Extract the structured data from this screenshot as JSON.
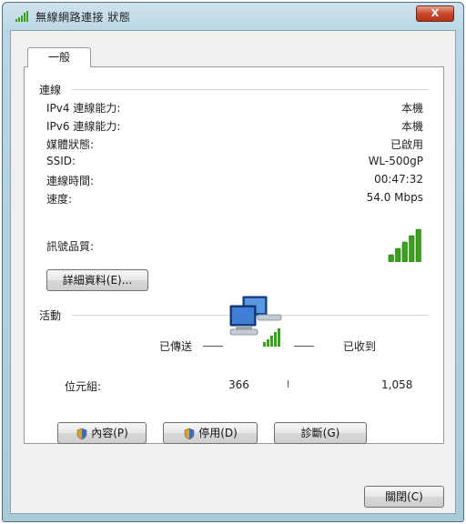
{
  "window": {
    "title": "無線網路連接 狀態",
    "close_label": "X"
  },
  "tabs": [
    {
      "label": "一般",
      "selected": true
    }
  ],
  "connection": {
    "group_title": "連線",
    "rows": [
      {
        "label": "IPv4 連線能力:",
        "value": "本機"
      },
      {
        "label": "IPv6 連線能力:",
        "value": "本機"
      },
      {
        "label": "媒體狀態:",
        "value": "已啟用"
      },
      {
        "label": "SSID:",
        "value": "WL-500gP"
      },
      {
        "label": "連線時間:",
        "value": "00:47:32"
      },
      {
        "label": "速度:",
        "value": "54.0 Mbps"
      }
    ],
    "signal_label": "訊號品質:",
    "signal_bars": 5,
    "signal_bars_max": 5,
    "details_button": "詳細資料(E)..."
  },
  "activity": {
    "group_title": "活動",
    "sent_label": "已傳送",
    "received_label": "已收到",
    "bytes_label": "位元組:",
    "bytes_sent": "366",
    "bytes_received": "1,058"
  },
  "buttons": {
    "properties": "內容(P)",
    "disable": "停用(D)",
    "diagnose": "診斷(G)",
    "close": "關閉(C)"
  },
  "colors": {
    "signal_green": "#3aa21a",
    "title_close_red": "#c8482c",
    "window_frame": "#b9d6e4"
  },
  "icons": [
    "signal-bars-icon",
    "network-computers-icon",
    "shield-icon"
  ]
}
